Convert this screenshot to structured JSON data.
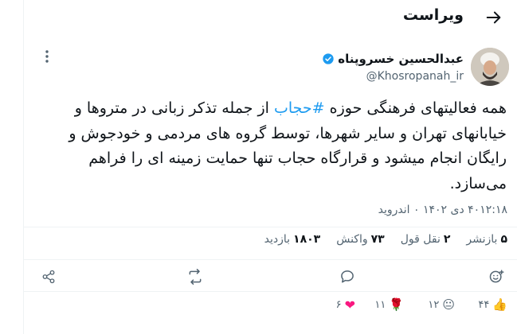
{
  "header": {
    "title": "ویراست"
  },
  "author": {
    "name": "عبدالحسین خسروپناه",
    "handle": "@Khosropanah_ir"
  },
  "tweet": {
    "text_before": "همه فعالیتهای فرهنگی حوزه ",
    "hashtag": "#حجاب",
    "text_after": " از جمله تذکر زبانی در متروها و خیابانهای تهران و سایر شهرها، توسط گروه های مردمی و خودجوش و رایگان انجام میشود و قرارگاه حجاب تنها حمایت زمینه ای را فراهم می‌سازد.",
    "timestamp": "۴۰۱۲:۱۸ دی ۱۴۰۲ ۰ اندروید"
  },
  "stats": [
    {
      "value": "۵",
      "label": "بازنشر"
    },
    {
      "value": "۲",
      "label": "نقل قول"
    },
    {
      "value": "۷۳",
      "label": "واکنش"
    },
    {
      "value": "۱۸۰۳",
      "label": "بازدید"
    }
  ],
  "reactions": [
    {
      "emoji": "👍",
      "count": "۴۴"
    },
    {
      "emoji": "😐",
      "count": "۱۲"
    },
    {
      "emoji": "🌹",
      "count": "۱۱"
    },
    {
      "emoji": "❤",
      "count": "۶"
    }
  ],
  "colors": {
    "accent": "#1d9bf0",
    "text": "#0f1419",
    "muted": "#536471",
    "border": "#eff3f4",
    "heart": "#f91880"
  },
  "icons": {
    "back": "arrow-right-icon",
    "more": "more-vertical-icon",
    "verified": "verified-badge-icon",
    "share": "share-icon",
    "repost": "repost-icon",
    "reply": "reply-icon",
    "add_reaction": "add-reaction-icon"
  }
}
